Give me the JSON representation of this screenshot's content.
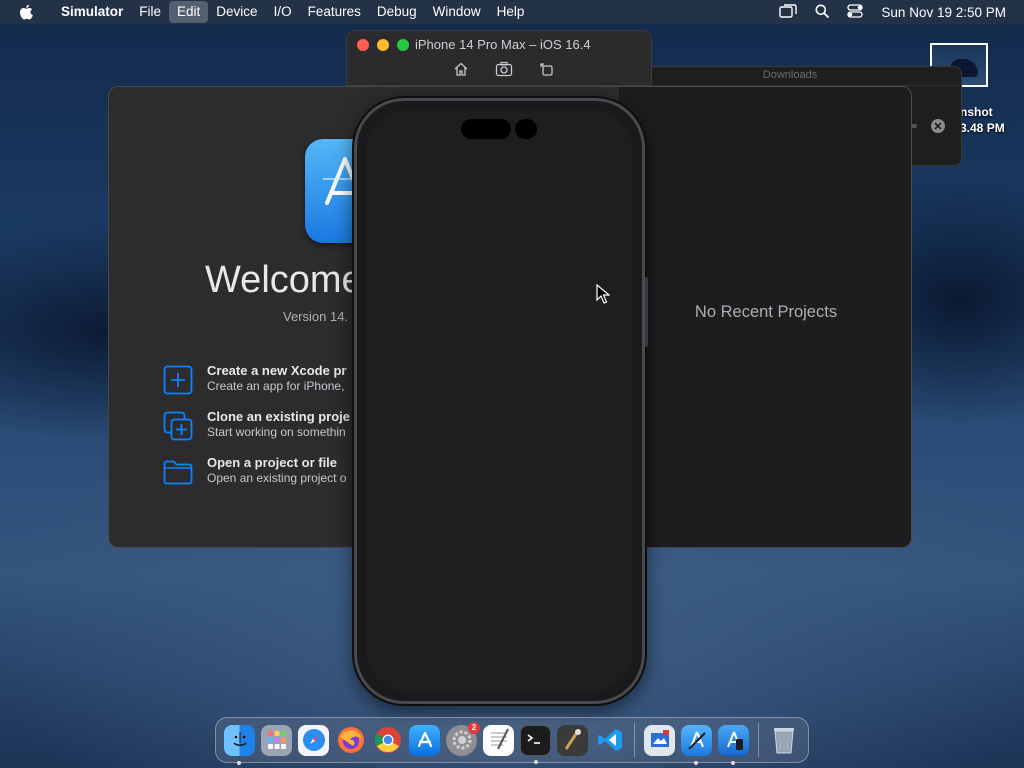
{
  "menubar": {
    "apple_icon": "apple-logo-icon",
    "items": [
      "Simulator",
      "File",
      "Edit",
      "Device",
      "I/O",
      "Features",
      "Debug",
      "Window",
      "Help"
    ],
    "active_item": "Edit",
    "clock": "Sun Nov 19  2:50 PM",
    "status_icons": [
      "screen-mirroring-icon",
      "search-icon",
      "control-center-icon"
    ]
  },
  "desktop": {
    "screenshot_label_line1": "nshot",
    "screenshot_label_line2": "3.48 PM"
  },
  "downloads_window": {
    "title": "Downloads"
  },
  "simulator": {
    "window_title": "iPhone 14 Pro Max – iOS 16.4",
    "toolbar": [
      "home-icon",
      "screenshot-icon",
      "rotate-icon"
    ]
  },
  "xcode_welcome": {
    "title": "Welcome",
    "version": "Version 14.",
    "actions": [
      {
        "icon": "plus-square-icon",
        "title": "Create a new Xcode pr",
        "subtitle": "Create an app for iPhone,"
      },
      {
        "icon": "clone-repo-icon",
        "title": "Clone an existing proje",
        "subtitle": "Start working on somethin"
      },
      {
        "icon": "folder-icon",
        "title": "Open a project or file",
        "subtitle": "Open an existing project o"
      }
    ],
    "no_recent": "No Recent Projects"
  },
  "dock": {
    "apps": [
      "Finder",
      "Launchpad",
      "Safari",
      "Firefox",
      "Chrome",
      "App Store",
      "System Settings",
      "TextEdit",
      "Terminal",
      "Instruments",
      "Visual Studio Code",
      "Preview",
      "Xcode",
      "Simulator",
      "Trash"
    ],
    "settings_badge": "2"
  },
  "colors": {
    "accent": "#0a84ff",
    "traffic_close": "#ff5f57",
    "traffic_min": "#febc2e",
    "traffic_max": "#28c840"
  }
}
